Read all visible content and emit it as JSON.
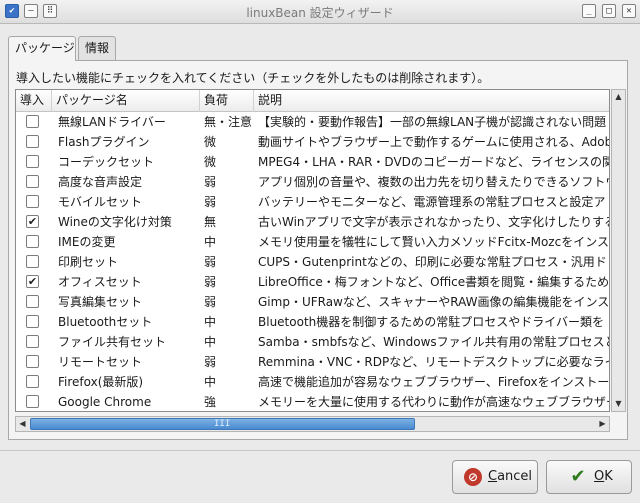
{
  "window": {
    "title": "linuxBean 設定ウィザード",
    "menu_icon": "checkbox-menu-icon",
    "control_icons": [
      "sticky-icon",
      "grid-icon"
    ],
    "minimize_glyph": "_",
    "maximize_glyph": "□",
    "close_glyph": "✕"
  },
  "tabs": [
    {
      "label": "パッケージ",
      "active": true
    },
    {
      "label": "情報",
      "active": false
    }
  ],
  "instruction": "導入したい機能にチェックを入れてください（チェックを外したものは削除されます）。",
  "columns": [
    "導入",
    "パッケージ名",
    "負荷",
    "説明"
  ],
  "rows": [
    {
      "checked": false,
      "name": "無線LANドライバー",
      "load": "無・注意",
      "desc": "【実験的・要動作報告】一部の無線LAN子機が認識されない問題"
    },
    {
      "checked": false,
      "name": "Flashプラグイン",
      "load": "微",
      "desc": "動画サイトやブラウザー上で動作するゲームに使用される、Adob"
    },
    {
      "checked": false,
      "name": "コーデックセット",
      "load": "微",
      "desc": "MPEG4・LHA・RAR・DVDのコピーガードなど、ライセンスの関係"
    },
    {
      "checked": false,
      "name": "高度な音声設定",
      "load": "弱",
      "desc": "アプリ個別の音量や、複数の出力先を切り替えたりできるソフトウ"
    },
    {
      "checked": false,
      "name": "モバイルセット",
      "load": "弱",
      "desc": "バッテリーやモニターなど、電源管理系の常駐プロセスと設定ア"
    },
    {
      "checked": true,
      "name": "Wineの文字化け対策",
      "load": "無",
      "desc": "古いWinアプリで文字が表示されなかったり、文字化けしたりする"
    },
    {
      "checked": false,
      "name": "IMEの変更",
      "load": "中",
      "desc": "メモリ使用量を犠牲にして賢い入力メソッドFcitx-Mozcをインスト"
    },
    {
      "checked": false,
      "name": "印刷セット",
      "load": "弱",
      "desc": "CUPS・Gutenprintなどの、印刷に必要な常駐プロセス・汎用ド"
    },
    {
      "checked": true,
      "name": "オフィスセット",
      "load": "弱",
      "desc": "LibreOffice・梅フォントなど、Office書類を閲覧・編集するために必"
    },
    {
      "checked": false,
      "name": "写真編集セット",
      "load": "弱",
      "desc": "Gimp・UFRawなど、スキャナーやRAW画像の編集機能をインスト"
    },
    {
      "checked": false,
      "name": "Bluetoothセット",
      "load": "中",
      "desc": "Bluetooth機器を制御するための常駐プロセスやドライバー類を"
    },
    {
      "checked": false,
      "name": "ファイル共有セット",
      "load": "中",
      "desc": "Samba・smbfsなど、Windowsファイル共有用の常駐プロセスと設"
    },
    {
      "checked": false,
      "name": "リモートセット",
      "load": "弱",
      "desc": "Remmina・VNC・RDPなど、リモートデスクトップに必要なライブラ"
    },
    {
      "checked": false,
      "name": "Firefox(最新版)",
      "load": "中",
      "desc": "高速で機能追加が容易なウェブブラウザー、Firefoxをインストール"
    },
    {
      "checked": false,
      "name": "Google Chrome",
      "load": "強",
      "desc": "メモリーを大量に使用する代わりに動作が高速なウェブブラウザー"
    }
  ],
  "scroll": {
    "up_glyph": "▲",
    "down_glyph": "▼",
    "left_glyph": "◀",
    "right_glyph": "▶",
    "grip": "III"
  },
  "buttons": {
    "cancel": {
      "label": "Cancel",
      "mnemonic": "C",
      "icon": "cancel-icon",
      "icon_color": "#c0392b"
    },
    "ok": {
      "label": "OK",
      "mnemonic": "O",
      "icon": "ok-icon",
      "icon_color": "#2f7a1e"
    }
  },
  "colors": {
    "scroll_thumb": "#5a96d8",
    "panel_bg": "#f4f4f4"
  }
}
